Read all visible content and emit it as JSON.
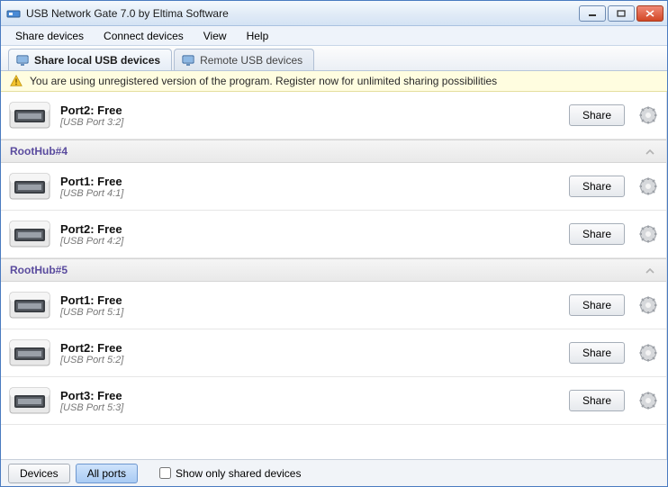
{
  "window": {
    "title": "USB Network Gate 7.0 by Eltima Software"
  },
  "menu": [
    "Share devices",
    "Connect devices",
    "View",
    "Help"
  ],
  "tabs": {
    "active": "Share local USB devices",
    "inactive": "Remote USB devices"
  },
  "warning": "You are using unregistered version of the program. Register now for unlimited sharing possibilities",
  "share_label": "Share",
  "hubs": [
    {
      "header": null,
      "ports": [
        {
          "name": "Port2: Free",
          "sub": "[USB Port 3:2]"
        }
      ]
    },
    {
      "header": "RootHub#4",
      "ports": [
        {
          "name": "Port1: Free",
          "sub": "[USB Port 4:1]"
        },
        {
          "name": "Port2: Free",
          "sub": "[USB Port 4:2]"
        }
      ]
    },
    {
      "header": "RootHub#5",
      "ports": [
        {
          "name": "Port1: Free",
          "sub": "[USB Port 5:1]"
        },
        {
          "name": "Port2: Free",
          "sub": "[USB Port 5:2]"
        },
        {
          "name": "Port3: Free",
          "sub": "[USB Port 5:3]"
        }
      ]
    }
  ],
  "bottom": {
    "devices": "Devices",
    "allports": "All ports",
    "checkbox": "Show only shared devices"
  }
}
